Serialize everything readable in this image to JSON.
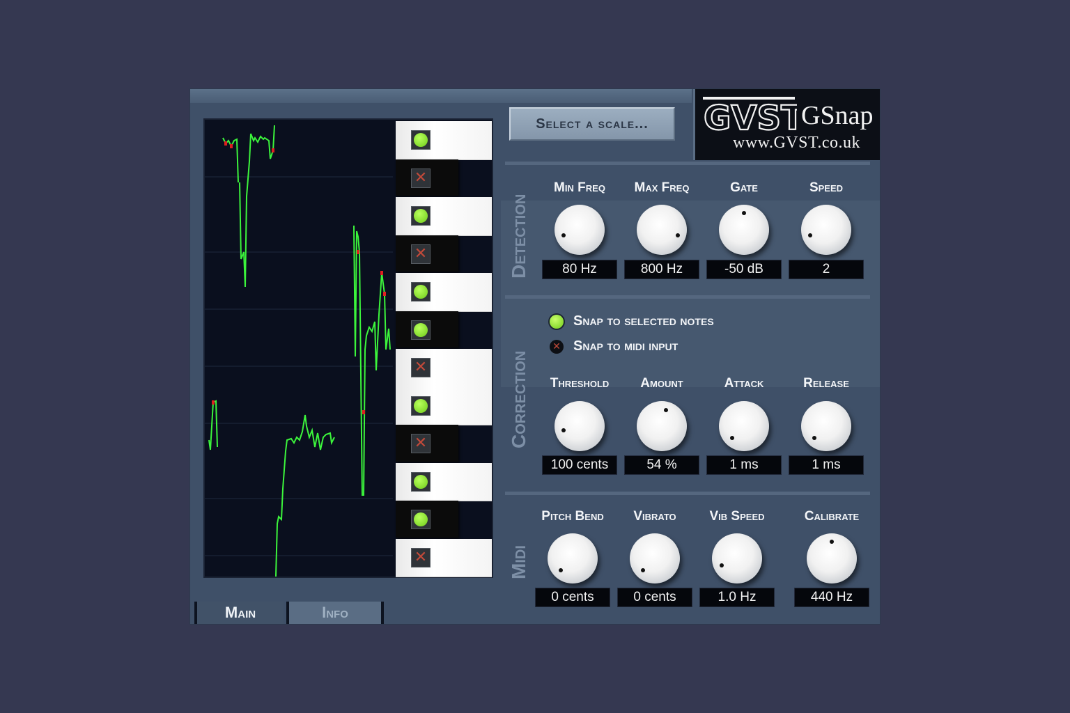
{
  "plugin": {
    "logo": {
      "mark": "GVST",
      "name": "GSnap",
      "url": "www.GVST.co.uk"
    },
    "scale_button": "Select a scale...",
    "tabs": [
      {
        "label": "Main",
        "active": true
      },
      {
        "label": "Info",
        "active": false
      }
    ],
    "sections": {
      "detection": {
        "label": "Detection",
        "knobs": [
          {
            "label": "Min Freq",
            "value": "80 Hz",
            "angle": -110
          },
          {
            "label": "Max Freq",
            "value": "800 Hz",
            "angle": 110
          },
          {
            "label": "Gate",
            "value": "-50 dB",
            "angle": 0
          },
          {
            "label": "Speed",
            "value": "2",
            "angle": -110
          }
        ]
      },
      "correction": {
        "label": "Correction",
        "options": [
          {
            "label": "Snap to selected notes",
            "selected": true
          },
          {
            "label": "Snap to midi input",
            "selected": false
          }
        ],
        "knobs": [
          {
            "label": "Threshold",
            "value": "100 cents",
            "angle": -105
          },
          {
            "label": "Amount",
            "value": "54 %",
            "angle": 15
          },
          {
            "label": "Attack",
            "value": "1 ms",
            "angle": -135
          },
          {
            "label": "Release",
            "value": "1 ms",
            "angle": -135
          }
        ]
      },
      "midi": {
        "label": "Midi",
        "knobs": [
          {
            "label": "Pitch Bend",
            "value": "0 cents",
            "angle": -135
          },
          {
            "label": "Vibrato",
            "value": "0 cents",
            "angle": -135
          },
          {
            "label": "Vib Speed",
            "value": "1.0 Hz",
            "angle": -115
          },
          {
            "label": "Calibrate",
            "value": "440 Hz",
            "angle": 0
          }
        ]
      }
    },
    "piano_notes": [
      {
        "type": "white",
        "enabled": true
      },
      {
        "type": "black",
        "enabled": false
      },
      {
        "type": "white",
        "enabled": true
      },
      {
        "type": "black",
        "enabled": false
      },
      {
        "type": "white",
        "enabled": true
      },
      {
        "type": "black",
        "enabled": true
      },
      {
        "type": "white",
        "enabled": false
      },
      {
        "type": "white",
        "enabled": true
      },
      {
        "type": "black",
        "enabled": false
      },
      {
        "type": "white",
        "enabled": true
      },
      {
        "type": "black",
        "enabled": true
      },
      {
        "type": "white",
        "enabled": false
      }
    ],
    "colors": {
      "pitch_line": "#3cf53c",
      "pitch_marker": "#e02020",
      "note_on": "#8ee82a",
      "note_off": "#c24a3a",
      "panel": "#3f5068"
    }
  }
}
